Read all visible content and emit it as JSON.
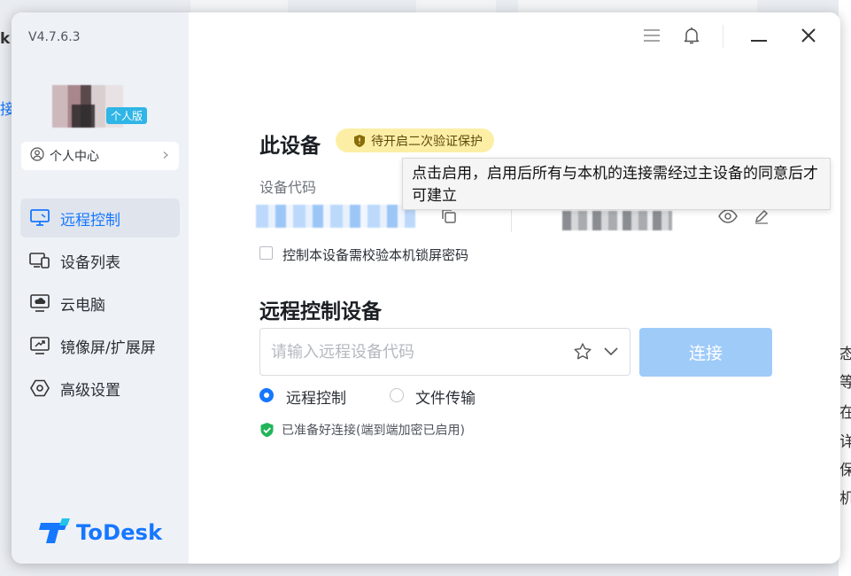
{
  "app": {
    "version": "V4.7.6.3",
    "plan_badge": "个人版",
    "user_center_label": "个人中心",
    "brand": "ToDesk",
    "accent": "#1677ff"
  },
  "sidebar": {
    "items": [
      {
        "label": "远程控制",
        "icon": "monitor-icon",
        "active": true
      },
      {
        "label": "设备列表",
        "icon": "devices-icon",
        "active": false
      },
      {
        "label": "云电脑",
        "icon": "cloud-pc-icon",
        "active": false
      },
      {
        "label": "镜像屏/扩展屏",
        "icon": "screen-mirror-icon",
        "active": false
      },
      {
        "label": "高级设置",
        "icon": "hexagon-settings-icon",
        "active": false
      }
    ]
  },
  "this_device": {
    "title": "此设备",
    "security_pill": "待开启二次验证保护",
    "tooltip": "点击启用，启用后所有与本机的连接需经过主设备的同意后才可建立",
    "code_label": "设备代码",
    "lock_password_checkbox": "控制本设备需校验本机锁屏密码"
  },
  "remote": {
    "title": "远程控制设备",
    "input_placeholder": "请输入远程设备代码",
    "connect_label": "连接",
    "modes": [
      "远程控制",
      "文件传输"
    ],
    "selected_mode": "远程控制",
    "status": "已准备好连接(端到端加密已启用)"
  },
  "background": {
    "left_fragments": [
      "k.",
      "接"
    ],
    "right_fragments": [
      "态",
      "等",
      "在",
      "详",
      "保",
      "机"
    ]
  }
}
